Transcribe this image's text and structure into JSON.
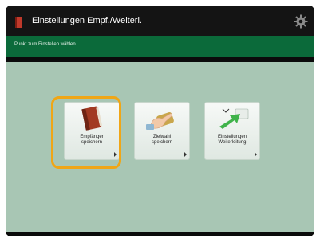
{
  "header": {
    "title": "Einstellungen Empf./Weiterl.",
    "app_icon": "book-icon",
    "settings_icon": "gear-icon"
  },
  "info_bar": {
    "text": "Punkt zum Einstellen wählen."
  },
  "tiles": [
    {
      "label_line1": "Empfänger",
      "label_line2": "speichern",
      "icon": "address-book-icon",
      "selected": true
    },
    {
      "label_line1": "Zielwahl",
      "label_line2": "speichern",
      "icon": "hand-press-icon",
      "selected": false
    },
    {
      "label_line1": "Einstellungen",
      "label_line2": "Weiterleitung",
      "icon": "forward-arrow-icon",
      "selected": false
    }
  ],
  "colors": {
    "title_bar": "#141414",
    "info_bar": "#0b6a3a",
    "main_bg": "#a8c6b4",
    "focus": "#f0a616"
  }
}
